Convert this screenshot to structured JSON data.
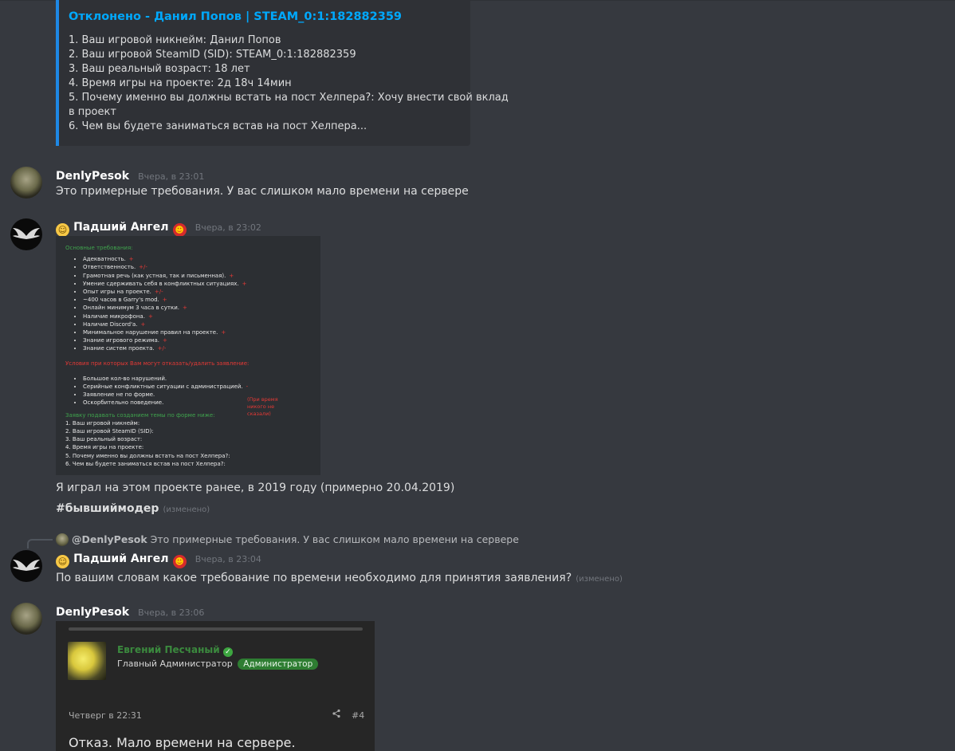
{
  "embed1": {
    "title": "Отклонено - Данил Попов | STEAM_0:1:182882359",
    "lines": [
      "1. Ваш игровой никнейм: Данил Попов",
      "2. Ваш игровой SteamID (SID): STEAM_0:1:182882359",
      "3. Ваш реальный возраст: 18 лет",
      "4. Время игры на проекте: 2д 18ч 14мин",
      "5. Почему именно вы должны встать на пост Хелпера?: Хочу внести свой вклад",
      "в проект",
      "6. Чем вы будете заниматься встав на пост Хелпера..."
    ]
  },
  "messages": {
    "m1": {
      "username": "DenlyPesok",
      "timestamp": "Вчера, в 23:01",
      "text": "Это примерные требования. У вас слишком мало времени на сервере"
    },
    "m2": {
      "username": "Падший Ангел",
      "timestamp": "Вчера, в 23:02",
      "text1": "Я играл на этом проекте ранее, в 2019 году (примерно 20.04.2019)",
      "text2": "#бывшиймодер",
      "edited": "(изменено)"
    },
    "reply": {
      "mention": "@DenlyPesok",
      "text": "Это примерные требования. У вас слишком мало времени на сервере"
    },
    "m3": {
      "username": "Падший Ангел",
      "timestamp": "Вчера, в 23:04",
      "text": "По вашим словам какое требование по времени необходимо для принятия заявления?",
      "edited": "(изменено)"
    },
    "m4": {
      "username": "DenlyPesok",
      "timestamp": "Вчера, в 23:06"
    }
  },
  "attachment": {
    "heading": "Основные требования:",
    "requirements": [
      {
        "text": "Адекватность.",
        "mark": "+"
      },
      {
        "text": "Ответственность.",
        "mark": "+/-"
      },
      {
        "text": "Грамотная речь (как устная, так и письменная).",
        "mark": "+"
      },
      {
        "text": "Умение сдерживать себя в конфликтных ситуациях.",
        "mark": "+"
      },
      {
        "text": "Опыт игры на проекте.",
        "mark": "+/-"
      },
      {
        "text": "~400 часов в Garry's mod.",
        "mark": "+"
      },
      {
        "text": "Онлайн минимум 3 часа в сутки.",
        "mark": "+"
      },
      {
        "text": "Наличие микрофона.",
        "mark": "+"
      },
      {
        "text": "Наличие Discord'a.",
        "mark": "+"
      },
      {
        "text": "Минимальное нарушение правил на проекте.",
        "mark": "+"
      },
      {
        "text": "Знание игрового режима.",
        "mark": "+"
      },
      {
        "text": "Знание систем проекта.",
        "mark": "+/-"
      }
    ],
    "refusal_heading": "Условия при которых Вам могут отказать/удалить заявление:",
    "refusals": [
      {
        "text": "Большое кол-во нарушений.",
        "mark": ""
      },
      {
        "text": "Серийные конфликтные ситуации с администрацией.",
        "mark": "-"
      },
      {
        "text": "Заявление не по форме.",
        "mark": ""
      },
      {
        "text": "Оскорбительно поведение.",
        "mark": ""
      }
    ],
    "note": "(При время никого не сказали)",
    "form_heading": "Заявку подавать созданием темы по форме ниже:",
    "form_lines": [
      "1. Ваш игровой никнейм:",
      "2. Ваш игровой SteamID (SID):",
      "3. Ваш реальный возраст:",
      "4. Время игры на проекте:",
      "5. Почему именно вы должны встать на пост Хелпера?:",
      "6. Чем вы будете заниматься встав на пост Хелпера?:"
    ]
  },
  "forum": {
    "author": "Евгений Песчаный",
    "role": "Главный Администратор",
    "badge": "Администратор",
    "date": "Четверг в 22:31",
    "post_number": "#4",
    "text": "Отказ. Мало времени на сервере."
  }
}
